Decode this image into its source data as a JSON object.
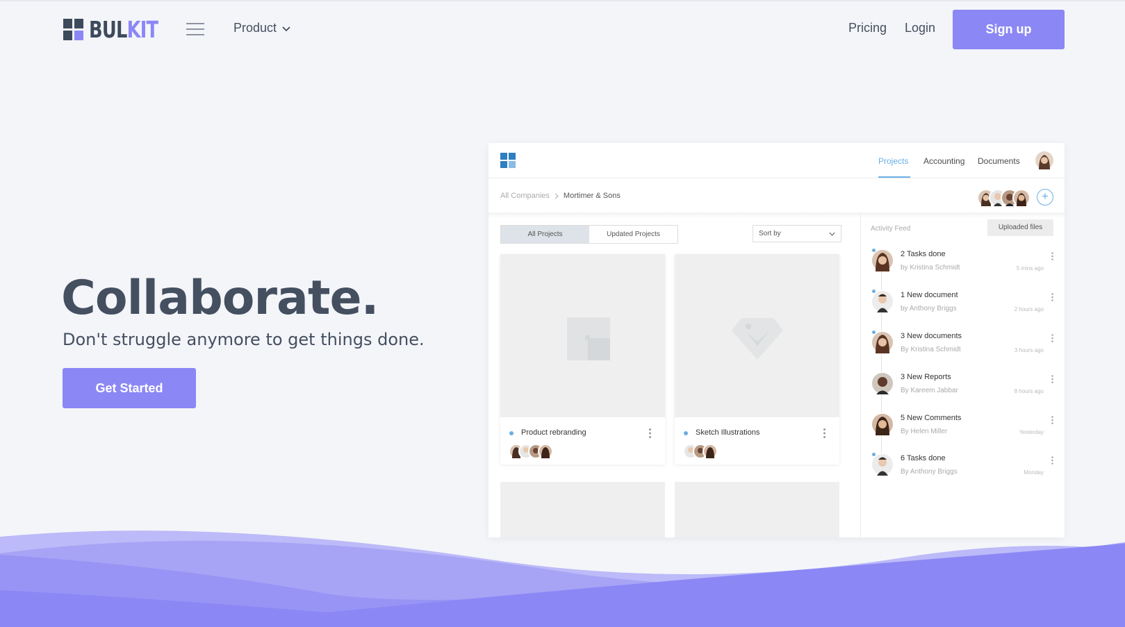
{
  "brand": {
    "part1": "BUL",
    "part2": "KIT"
  },
  "nav": {
    "product": "Product",
    "pricing": "Pricing",
    "login": "Login",
    "signup": "Sign up"
  },
  "hero": {
    "title": "Collaborate.",
    "subtitle": "Don't struggle anymore to get things done.",
    "cta": "Get Started"
  },
  "mockup": {
    "tabs": [
      "Projects",
      "Accounting",
      "Documents"
    ],
    "active_tab": "Projects",
    "breadcrumb": {
      "root": "All Companies",
      "current": "Mortimer & Sons"
    },
    "segments": [
      "All Projects",
      "Updated Projects"
    ],
    "sort_label": "Sort by",
    "projects": [
      {
        "title": "Product rebranding"
      },
      {
        "title": "Sketch Illustrations"
      }
    ],
    "feed": {
      "title": "Activity Feed",
      "button": "Uploaded files",
      "items": [
        {
          "title": "2 Tasks done",
          "by": "by Kristina Schmidt",
          "time": "5 mins ago"
        },
        {
          "title": "1 New document",
          "by": "by Anthony Briggs",
          "time": "2 hours ago"
        },
        {
          "title": "3 New documents",
          "by": "By Kristina Schmidt",
          "time": "3 hours ago"
        },
        {
          "title": "3 New Reports",
          "by": "By Kareem Jabbar",
          "time": "8 hours ago"
        },
        {
          "title": "5 New Comments",
          "by": "By Helen Miller",
          "time": "Yesterday"
        },
        {
          "title": "6 Tasks done",
          "by": "By Anthony Briggs",
          "time": "Monday"
        }
      ]
    }
  },
  "colors": {
    "accent": "#8b87f5",
    "text": "#444f60",
    "background": "#f4f5f9",
    "mock_accent": "#6aaee5"
  }
}
